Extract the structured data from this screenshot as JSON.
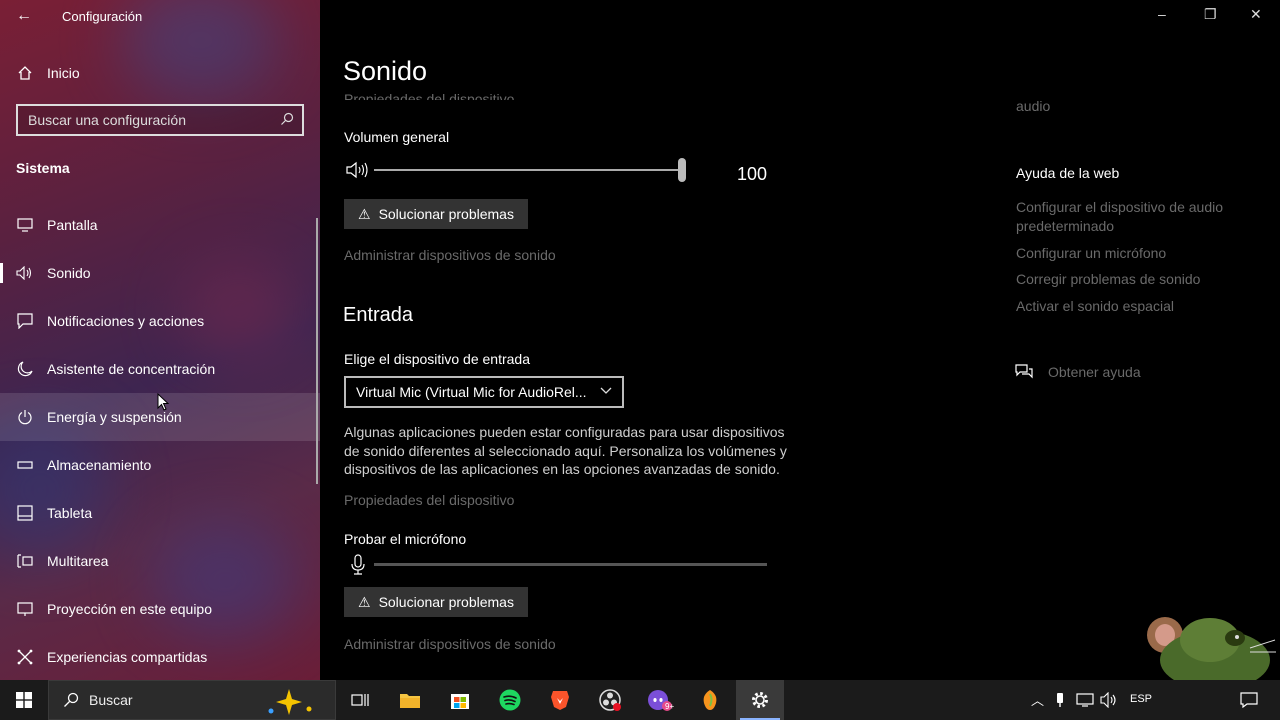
{
  "window": {
    "title": "Configuración",
    "minimize": "–",
    "restore": "❐",
    "close": "✕"
  },
  "sidebar": {
    "home_label": "Inicio",
    "search_placeholder": "Buscar una configuración",
    "section_title": "Sistema",
    "items": [
      {
        "label": "Pantalla",
        "icon": "display-icon"
      },
      {
        "label": "Sonido",
        "icon": "speaker-icon"
      },
      {
        "label": "Notificaciones y acciones",
        "icon": "notification-icon"
      },
      {
        "label": "Asistente de concentración",
        "icon": "moon-icon"
      },
      {
        "label": "Energía y suspensión",
        "icon": "power-icon"
      },
      {
        "label": "Almacenamiento",
        "icon": "storage-icon"
      },
      {
        "label": "Tableta",
        "icon": "tablet-icon"
      },
      {
        "label": "Multitarea",
        "icon": "multitask-icon"
      },
      {
        "label": "Proyección en este equipo",
        "icon": "projection-icon"
      },
      {
        "label": "Experiencias compartidas",
        "icon": "shared-icon"
      }
    ]
  },
  "main": {
    "title": "Sonido",
    "output": {
      "properties_link": "Propiedades del dispositivo",
      "volume_label": "Volumen general",
      "volume_value": "100",
      "volume_level": 1.0,
      "troubleshoot_label": "Solucionar problemas",
      "manage_link": "Administrar dispositivos de sonido"
    },
    "input": {
      "heading": "Entrada",
      "choose_label": "Elige el dispositivo de entrada",
      "selected_device": "Virtual Mic (Virtual Mic for AudioRel...",
      "description": "Algunas aplicaciones pueden estar configuradas para usar dispositivos de sonido diferentes al seleccionado aquí. Personaliza los volúmenes y dispositivos de las aplicaciones en las opciones avanzadas de sonido.",
      "properties_link": "Propiedades del dispositivo",
      "test_label": "Probar el micrófono",
      "mic_level": 0.0,
      "troubleshoot_label": "Solucionar problemas",
      "manage_link": "Administrar dispositivos de sonido"
    }
  },
  "right": {
    "audio_fragment": "audio",
    "help_heading": "Ayuda de la web",
    "links": [
      "Configurar el dispositivo de audio predeterminado",
      "Configurar un micrófono",
      "Corregir problemas de sonido",
      "Activar el sonido espacial"
    ],
    "get_help": "Obtener ayuda"
  },
  "taskbar": {
    "search_label": "Buscar",
    "lang": "ESP",
    "mail_badge": "9+"
  }
}
